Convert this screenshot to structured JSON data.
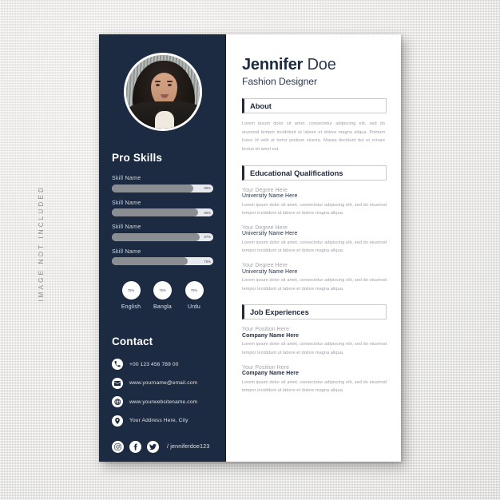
{
  "watermark": "IMAGE NOT INCLUDED",
  "theme": {
    "navy": "#1c2b41",
    "paper": "#ffffff",
    "muted_text": "#9a9ea5",
    "skill_fill": "#8a8d92"
  },
  "header": {
    "first_name": "Jennifer",
    "last_name": "Doe",
    "job_title": "Fashion Designer"
  },
  "sidebar": {
    "photo_alt": "profile-photo",
    "skills_heading": "Pro Skills",
    "skills": [
      {
        "name": "Skill Name",
        "percent": "80%",
        "value": 80
      },
      {
        "name": "Skill Name",
        "percent": "85%",
        "value": 85
      },
      {
        "name": "Skill Name",
        "percent": "87%",
        "value": 87
      },
      {
        "name": "Skill Name",
        "percent": "75%",
        "value": 75
      }
    ],
    "languages": [
      {
        "name": "English",
        "percent": "75%"
      },
      {
        "name": "Bangla",
        "percent": "75%"
      },
      {
        "name": "Urdu",
        "percent": "75%"
      }
    ],
    "contact_heading": "Contact",
    "contact": [
      {
        "icon": "phone-icon",
        "text": "+00 123 456 789 00"
      },
      {
        "icon": "envelope-icon",
        "text": "www.yourname@email.com"
      },
      {
        "icon": "globe-icon",
        "text": "www.yourwebsitename.com"
      },
      {
        "icon": "location-pin-icon",
        "text": "Your Address Here, City"
      }
    ],
    "socials": [
      {
        "icon": "instagram-icon"
      },
      {
        "icon": "facebook-icon"
      },
      {
        "icon": "twitter-icon"
      }
    ],
    "social_handle": "/ jenniferdoe123"
  },
  "main": {
    "about": {
      "heading": "About",
      "text": "Lorem ipsum dolor sit amet, consectetur adipiscing elit, sed do eiusmod tempor incididunt ut labore et dolore magna aliqua. Pretium fusce id velit ut tortor pretium viverra. Massa tincidunt dui ut ornare lectus sit amet est."
    },
    "education": {
      "heading": "Educational Qualifications",
      "entries": [
        {
          "degree": "Your Degree Here",
          "university": "University Name Here",
          "description": "Lorem ipsum dolor sit amet, consectetur adipiscing elit, sed do eiusmod tempor incididunt ut labore et dolore magna aliqua."
        },
        {
          "degree": "Your Degree Here",
          "university": "University Name Here",
          "description": "Lorem ipsum dolor sit amet, consectetur adipiscing elit, sed do eiusmod tempor incididunt ut labore et dolore magna aliqua."
        },
        {
          "degree": "Your Degree Here",
          "university": "University Name Here",
          "description": "Lorem ipsum dolor sit amet, consectetur adipiscing elit, sed do eiusmod tempor incididunt ut labore et dolore magna aliqua."
        }
      ]
    },
    "experience": {
      "heading": "Job Experiences",
      "entries": [
        {
          "position": "Your Position Here",
          "company": "Company Name Here",
          "description": "Lorem ipsum dolor sit amet, consectetur adipiscing elit, sed do eiusmod tempor incididunt ut labore et dolore magna aliqua."
        },
        {
          "position": "Your Position Here",
          "company": "Company Name Here",
          "description": "Lorem ipsum dolor sit amet, consectetur adipiscing elit, sed do eiusmod tempor incididunt ut labore et dolore magna aliqua."
        }
      ]
    }
  }
}
